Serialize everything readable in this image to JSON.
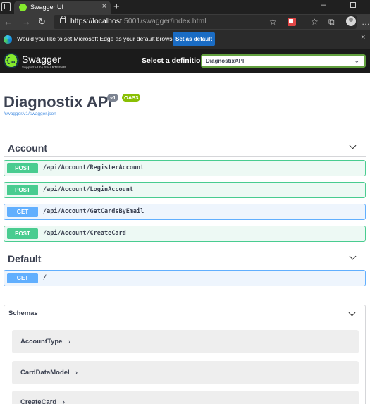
{
  "browser": {
    "tab_title": "Swagger UI",
    "tab_close": "×",
    "new_tab": "+",
    "url_scheme": "https://",
    "url_host": "localhost",
    "url_rest": ":5001/swagger/index.html",
    "infobar_text": "Would you like to set Microsoft Edge as your default browser?",
    "infobar_button": "Set as default",
    "infobar_close": "×"
  },
  "swagger": {
    "logo_text": "Swagger",
    "logo_sub": "Supported by SMARTBEAR",
    "select_label": "Select a definition",
    "selected_definition": "DiagnostixAPI",
    "api_title": "Diagnostix API",
    "version_badge": "v1",
    "oas_badge": "OAS3",
    "spec_link": "/swagger/v1/swagger.json"
  },
  "tags": [
    {
      "name": "Account",
      "operations": [
        {
          "method": "POST",
          "path": "/api/Account/RegisterAccount"
        },
        {
          "method": "POST",
          "path": "/api/Account/LoginAccount"
        },
        {
          "method": "GET",
          "path": "/api/Account/GetCardsByEmail"
        },
        {
          "method": "POST",
          "path": "/api/Account/CreateCard"
        }
      ]
    },
    {
      "name": "Default",
      "operations": [
        {
          "method": "GET",
          "path": "/"
        }
      ]
    }
  ],
  "schemas": {
    "title": "Schemas",
    "models": [
      "AccountType",
      "CardDataModel",
      "CreateCard"
    ]
  },
  "colors": {
    "post": "#49cc90",
    "get": "#61affe",
    "swagger_green": "#85ea2d",
    "topbar": "#1b1b1b"
  }
}
